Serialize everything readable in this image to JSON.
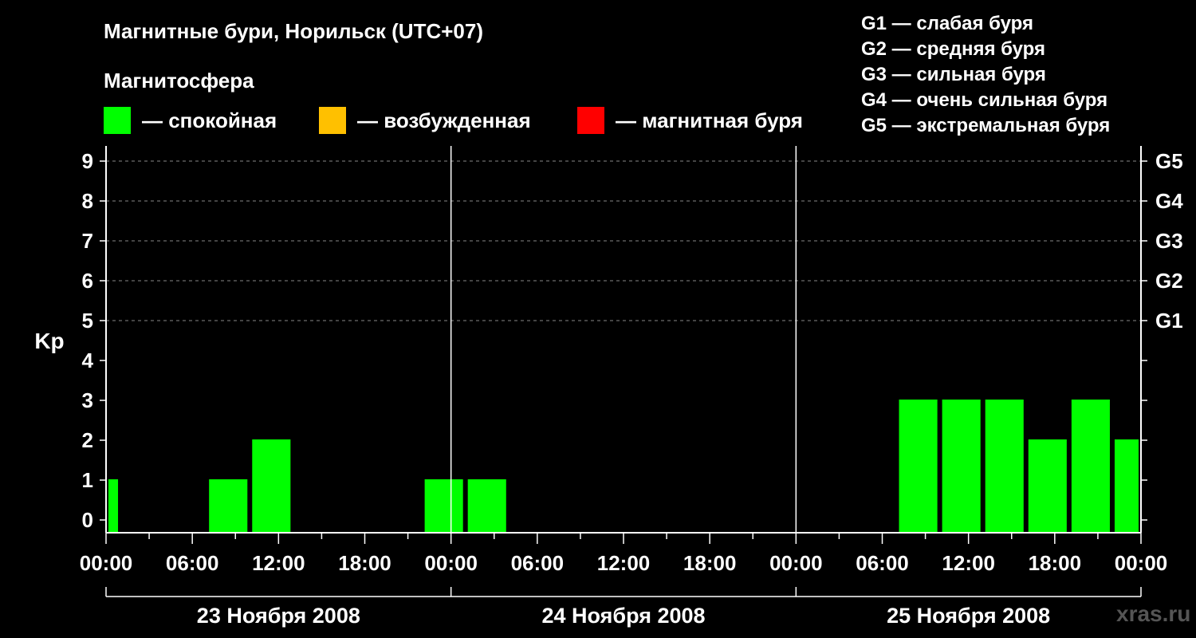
{
  "header": {
    "title": "Магнитные бури, Норильск (UTC+07)",
    "subtitle": "Магнитосфера"
  },
  "legend": [
    {
      "label": "— спокойная",
      "color": "#00ff00"
    },
    {
      "label": "— возбужденная",
      "color": "#ffc000"
    },
    {
      "label": "— магнитная буря",
      "color": "#ff0000"
    }
  ],
  "g_levels": [
    "G1 — слабая буря",
    "G2 — средняя буря",
    "G3 — сильная буря",
    "G4 — очень сильная буря",
    "G5 — экстремальная буря"
  ],
  "watermark": "xras.ru",
  "chart_data": {
    "type": "bar",
    "ylabel": "Kp",
    "ylim": [
      0,
      9
    ],
    "yticks": [
      0,
      1,
      2,
      3,
      4,
      5,
      6,
      7,
      8,
      9
    ],
    "right_ticks": [
      {
        "value": 5,
        "label": "G1"
      },
      {
        "value": 6,
        "label": "G2"
      },
      {
        "value": 7,
        "label": "G3"
      },
      {
        "value": 8,
        "label": "G4"
      },
      {
        "value": 9,
        "label": "G5"
      }
    ],
    "x_range_hours": [
      0,
      72
    ],
    "x_tick_labels": [
      "00:00",
      "06:00",
      "12:00",
      "18:00",
      "00:00",
      "06:00",
      "12:00",
      "18:00",
      "00:00",
      "06:00",
      "12:00",
      "18:00",
      "00:00"
    ],
    "days": [
      "23 Ноября 2008",
      "24 Ноября 2008",
      "25 Ноября 2008"
    ],
    "grid": "horizontal dashed at Kp 5-9",
    "bar_color": "#00ff00",
    "bars": [
      {
        "start": "23 Ноября 2008 00:00",
        "end": "23 Ноября 2008 01:00",
        "kp": 1
      },
      {
        "start": "23 Ноября 2008 07:00",
        "end": "23 Ноября 2008 10:00",
        "kp": 1
      },
      {
        "start": "23 Ноября 2008 10:00",
        "end": "23 Ноября 2008 13:00",
        "kp": 2
      },
      {
        "start": "23 Ноября 2008 22:00",
        "end": "24 Ноября 2008 01:00",
        "kp": 1
      },
      {
        "start": "24 Ноября 2008 01:00",
        "end": "24 Ноября 2008 04:00",
        "kp": 1
      },
      {
        "start": "25 Ноября 2008 07:00",
        "end": "25 Ноября 2008 10:00",
        "kp": 3
      },
      {
        "start": "25 Ноября 2008 10:00",
        "end": "25 Ноября 2008 13:00",
        "kp": 3
      },
      {
        "start": "25 Ноября 2008 13:00",
        "end": "25 Ноября 2008 16:00",
        "kp": 3
      },
      {
        "start": "25 Ноября 2008 16:00",
        "end": "25 Ноября 2008 19:00",
        "kp": 2
      },
      {
        "start": "25 Ноября 2008 19:00",
        "end": "25 Ноября 2008 22:00",
        "kp": 3
      },
      {
        "start": "25 Ноября 2008 22:00",
        "end": "26 Ноября 2008 00:00",
        "kp": 2
      }
    ]
  }
}
